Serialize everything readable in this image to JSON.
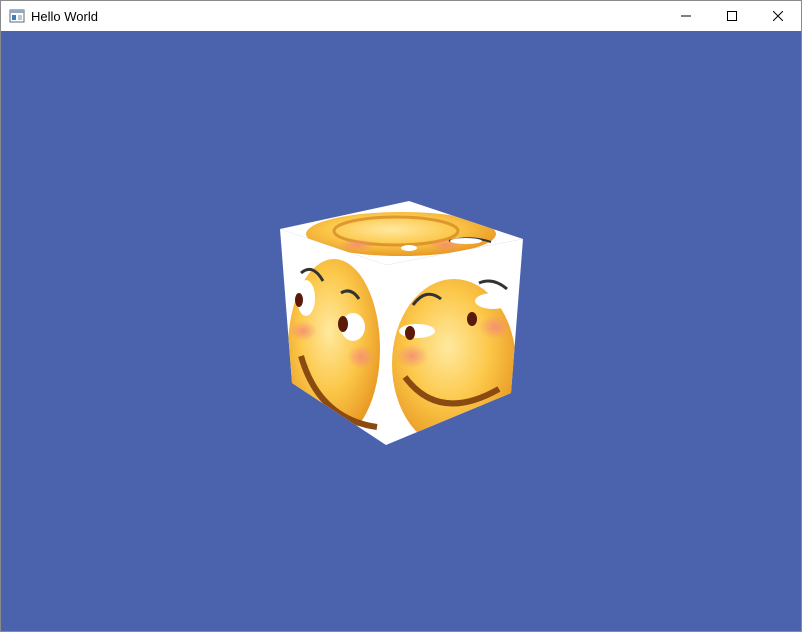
{
  "window": {
    "title": "Hello World",
    "controls": {
      "minimize_icon": "minimize-icon",
      "maximize_icon": "maximize-icon",
      "close_icon": "close-icon"
    }
  },
  "viewport": {
    "background_color": "#4a63ac",
    "object": "textured-cube",
    "face_texture": "smiling-emoji-face"
  }
}
